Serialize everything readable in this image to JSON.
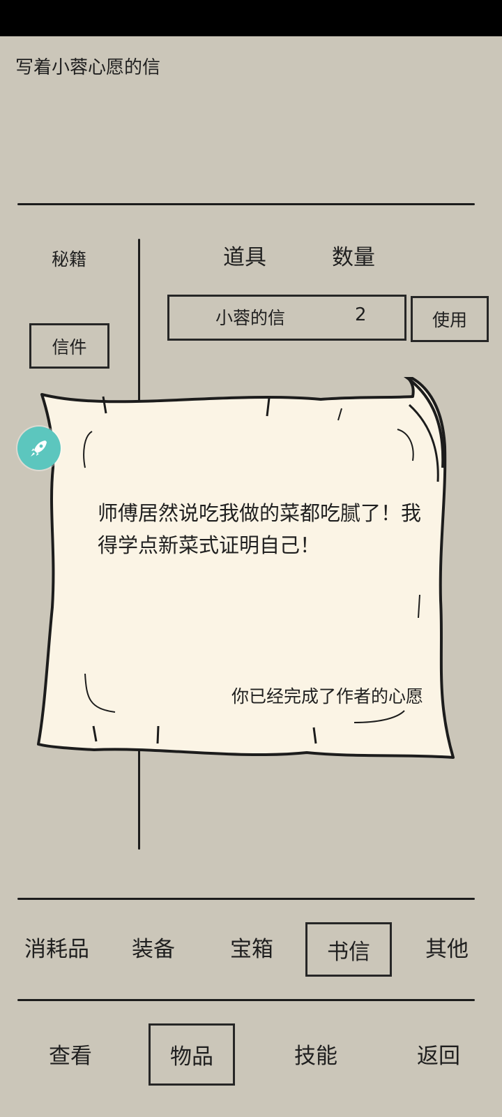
{
  "item_description": "写着小蓉心愿的信",
  "sidebar": {
    "secret_books": "秘籍",
    "letters": "信件"
  },
  "table": {
    "col_item": "道具",
    "col_qty": "数量",
    "rows": [
      {
        "name": "小蓉的信",
        "qty": "2"
      }
    ],
    "use_label": "使用"
  },
  "letter": {
    "body": "师傅居然说吃我做的菜都吃腻了！我得学点新菜式证明自己！",
    "footer": "你已经完成了作者的心愿"
  },
  "category_tabs": [
    {
      "label": "消耗品"
    },
    {
      "label": "装备"
    },
    {
      "label": "宝箱"
    },
    {
      "label": "书信"
    },
    {
      "label": "其他"
    }
  ],
  "nav": [
    {
      "label": "查看"
    },
    {
      "label": "物品"
    },
    {
      "label": "技能"
    },
    {
      "label": "返回"
    }
  ],
  "colors": {
    "background": "#cbc6b9",
    "paper": "#fbf4e5",
    "ink": "#1c1c1c",
    "float_button": "#5cc6be"
  },
  "icons": {
    "float_button": "rocket-icon"
  }
}
